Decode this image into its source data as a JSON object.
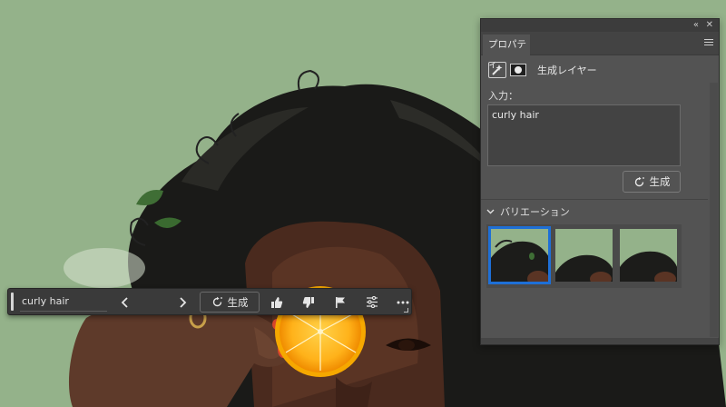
{
  "canvas": {
    "background_color": "#94b28a",
    "description_icon": "photo"
  },
  "taskbar": {
    "prompt_value": "curly hair",
    "prev_icon": "chevron-left-icon",
    "next_icon": "chevron-right-icon",
    "generate_label": "生成",
    "icons": [
      "thumbs-up-icon",
      "thumbs-down-icon",
      "flag-icon",
      "sliders-icon",
      "more-icon"
    ]
  },
  "panel": {
    "collapse_icon": "double-chevron-left-icon",
    "close_icon": "close-icon",
    "tab_label": "プロパティ",
    "layer_type_label": "生成レイヤー",
    "input_label": "入力：",
    "prompt_text": "curly hair",
    "generate_label": "生成",
    "variations_label": "バリエーション",
    "variation_count": 3,
    "selected_variation": 1,
    "accent_color": "#1e6fd6"
  }
}
